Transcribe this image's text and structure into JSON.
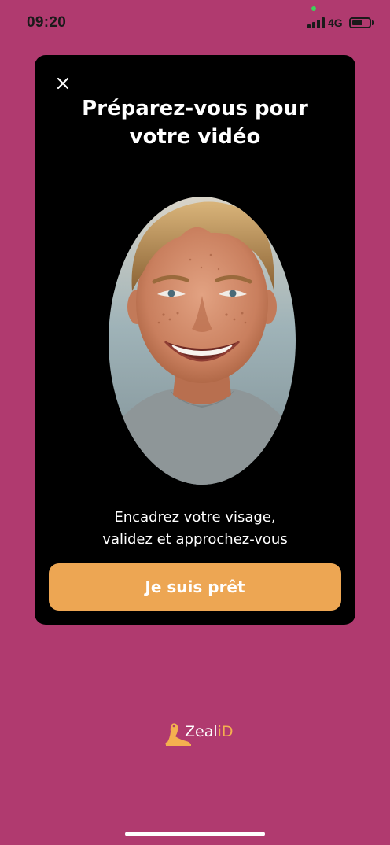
{
  "status_bar": {
    "time": "09:20",
    "network": "4G",
    "battery_level": 0.65
  },
  "modal": {
    "close_icon": "close-icon",
    "title_line1": "Préparez-vous pour",
    "title_line2": "votre vidéo",
    "instructions_line1": "Encadrez votre visage,",
    "instructions_line2": "validez et approchez-vous",
    "button_label": "Je suis prêt"
  },
  "logo": {
    "icon": "seal-icon",
    "text_main": "Zeal",
    "text_accent": "iD"
  },
  "colors": {
    "background": "#b03a6f",
    "card": "#000000",
    "button": "#eda653",
    "logo_accent": "#f4b04f"
  }
}
